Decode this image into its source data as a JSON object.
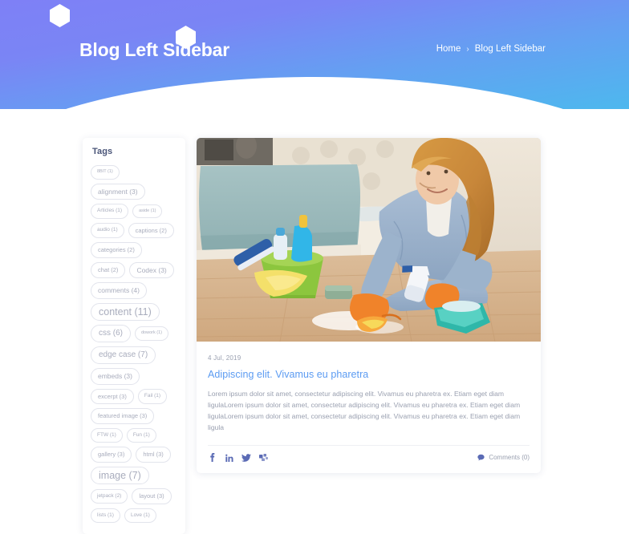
{
  "header": {
    "title": "Blog Left Sidebar",
    "breadcrumb": {
      "home": "Home",
      "separator": "›",
      "current": "Blog Left Sidebar"
    },
    "colors": {
      "gradient_top": "#7e80f6",
      "gradient_bottom": "#4db8ee",
      "text": "#ffffff"
    }
  },
  "sidebar": {
    "widget_title": "Tags",
    "tags": [
      {
        "label": "8BIT (1)",
        "size": "s1"
      },
      {
        "label": "alignment (3)",
        "size": "s4"
      },
      {
        "label": "Articles (1)",
        "size": "s2"
      },
      {
        "label": "aside (1)",
        "size": "s1"
      },
      {
        "label": "audio (1)",
        "size": "s2"
      },
      {
        "label": "captions (2)",
        "size": "s3"
      },
      {
        "label": "categories (2)",
        "size": "s3"
      },
      {
        "label": "chat (2)",
        "size": "s3"
      },
      {
        "label": "Codex (3)",
        "size": "s4"
      },
      {
        "label": "comments (4)",
        "size": "s4"
      },
      {
        "label": "content (11)",
        "size": "s6"
      },
      {
        "label": "css (6)",
        "size": "s5"
      },
      {
        "label": "dowork (1)",
        "size": "s1"
      },
      {
        "label": "edge case (7)",
        "size": "s5"
      },
      {
        "label": "embeds (3)",
        "size": "s4"
      },
      {
        "label": "excerpt (3)",
        "size": "s3"
      },
      {
        "label": "Fail (1)",
        "size": "s2"
      },
      {
        "label": "featured image (3)",
        "size": "s3"
      },
      {
        "label": "FTW (1)",
        "size": "s2"
      },
      {
        "label": "Fun (1)",
        "size": "s2"
      },
      {
        "label": "gallery (3)",
        "size": "s3"
      },
      {
        "label": "html (3)",
        "size": "s3"
      },
      {
        "label": "image (7)",
        "size": "s6"
      },
      {
        "label": "jetpack (2)",
        "size": "s2"
      },
      {
        "label": "layout (3)",
        "size": "s3"
      },
      {
        "label": "lists (1)",
        "size": "s2"
      },
      {
        "label": "Love (1)",
        "size": "s2"
      }
    ]
  },
  "post": {
    "image_alt": "Woman in denim jacket with orange rubber gloves cleaning a wooden floor with sponge and spray bottle beside a green bucket of cleaning supplies",
    "date": "4 Jul, 2019",
    "title": "Adipiscing elit. Vivamus eu pharetra",
    "excerpt": "Lorem ipsum dolor sit amet, consectetur adipiscing elit. Vivamus eu pharetra ex. Etiam eget diam ligulaLorem ipsum dolor sit amet, consectetur adipiscing elit. Vivamus eu pharetra ex. Etiam eget diam ligulaLorem ipsum dolor sit amet, consectetur adipiscing elit. Vivamus eu pharetra ex. Etiam eget diam ligula",
    "socials": [
      {
        "name": "facebook"
      },
      {
        "name": "linkedin"
      },
      {
        "name": "twitter"
      },
      {
        "name": "flickr"
      }
    ],
    "comments_label": "Comments (0)",
    "title_color": "#5b9bf2"
  }
}
